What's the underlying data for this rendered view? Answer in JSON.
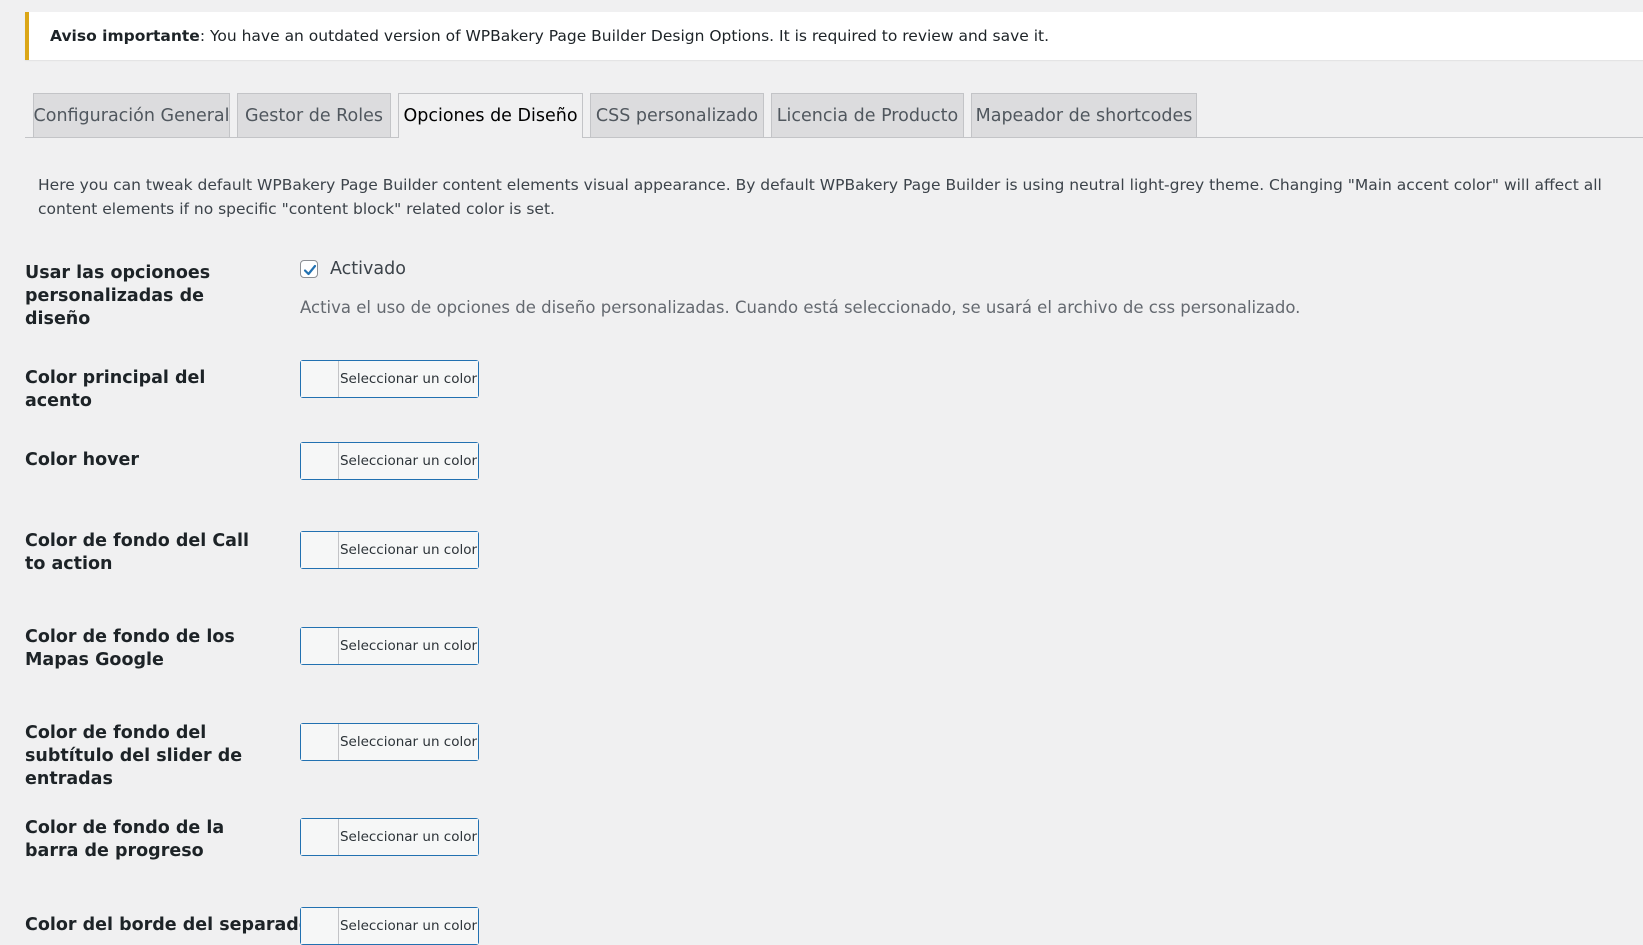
{
  "notice": {
    "strong": "Aviso importante",
    "message": ": You have an outdated version of WPBakery Page Builder Design Options. It is required to review and save it."
  },
  "tabs": [
    {
      "label": "Configuración General",
      "active": false
    },
    {
      "label": "Gestor de Roles",
      "active": false
    },
    {
      "label": "Opciones de Diseño",
      "active": true
    },
    {
      "label": "CSS personalizado",
      "active": false
    },
    {
      "label": "Licencia de Producto",
      "active": false
    },
    {
      "label": "Mapeador de shortcodes",
      "active": false
    }
  ],
  "description": "Here you can tweak default WPBakery Page Builder content elements visual appearance. By default WPBakery Page Builder is using neutral light-grey theme. Changing \"Main accent color\" will affect all content elements if no specific \"content block\" related color is set.",
  "use_custom": {
    "label": "Usar las opcionoes personalizadas de diseño",
    "checkbox_label": "Activado",
    "checked": true,
    "help": "Activa el uso de opciones de diseño personalizadas. Cuando está seleccionado, se usará el archivo de css personalizado."
  },
  "color_button_label": "Seleccionar un color",
  "color_rows": [
    {
      "label": "Color principal del acento"
    },
    {
      "label": "Color hover"
    },
    {
      "label": "Color de fondo del Call to action"
    },
    {
      "label": "Color de fondo de los Mapas Google"
    },
    {
      "label": "Color de fondo del subtítulo del slider de entradas"
    },
    {
      "label": "Color de fondo de la barra de progreso"
    },
    {
      "label": "Color del borde del separador"
    }
  ],
  "colors": {
    "notice_border": "#dba617",
    "focus_border": "#2271b1",
    "checkmark": "#2271b1"
  }
}
